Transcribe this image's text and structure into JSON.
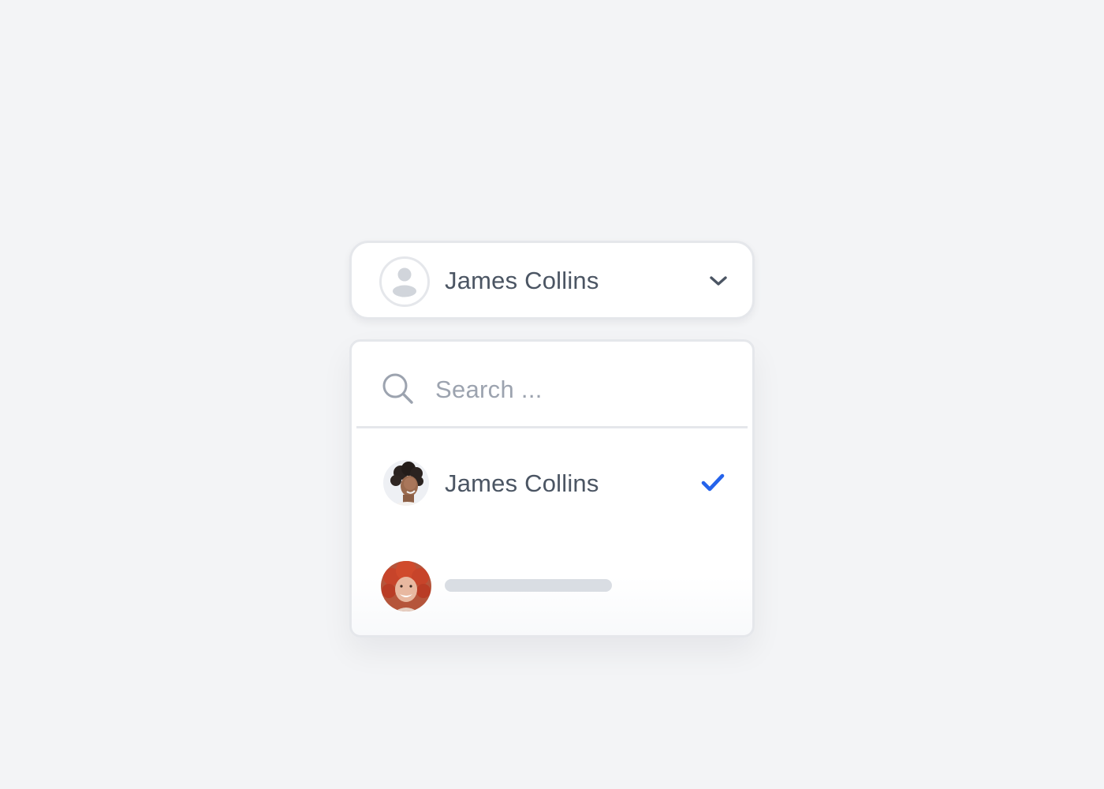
{
  "select": {
    "selected_label": "James Collins",
    "placeholder_avatar_icon": "user-placeholder-icon",
    "toggle_icon": "chevron-down-icon"
  },
  "dropdown": {
    "search": {
      "icon": "search-icon",
      "placeholder": "Search ...",
      "value": ""
    },
    "options": [
      {
        "label": "James Collins",
        "selected": true,
        "avatar": "avatar-photo-curly-hair",
        "indicator_icon": "check-icon"
      },
      {
        "label": "",
        "selected": false,
        "avatar": "avatar-photo-red-hair",
        "loading": true
      }
    ]
  },
  "colors": {
    "background": "#f3f4f6",
    "surface": "#ffffff",
    "border": "#e5e7eb",
    "text": "#4b5563",
    "placeholder_text": "#9ca3af",
    "accent": "#2563eb",
    "skeleton": "#d9dde3"
  }
}
